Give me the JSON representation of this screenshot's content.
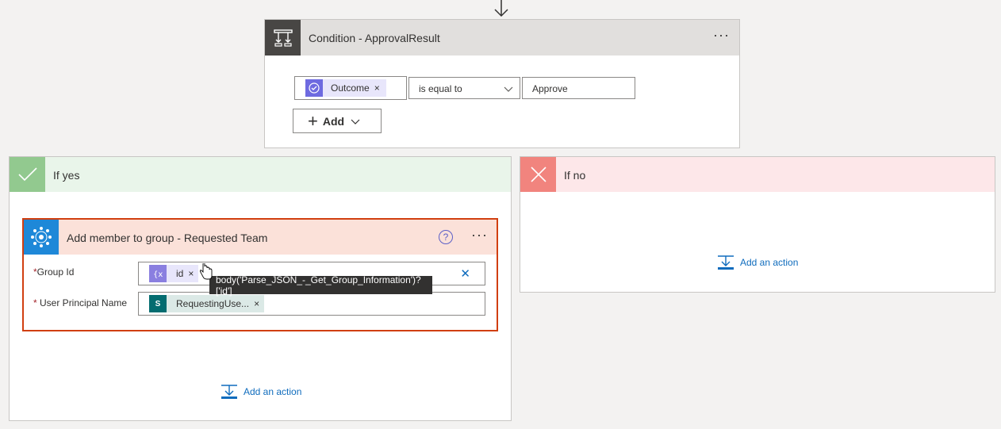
{
  "condition": {
    "title": "Condition - ApprovalResult",
    "more_label": "···",
    "left_operand": {
      "label": "Outcome",
      "remove": "×"
    },
    "operator": "is equal to",
    "right_value": "Approve",
    "add_button": "Add"
  },
  "yes_branch": {
    "title": "If yes",
    "action": {
      "title": "Add member to group - Requested Team",
      "help": "?",
      "more_label": "···",
      "fields": [
        {
          "required": "*",
          "label": "Group Id",
          "token": "id",
          "remove": "×",
          "clear": "✕"
        },
        {
          "required": "*",
          "label": "User Principal Name",
          "token": "RequestingUse...",
          "token_prefix": "S",
          "remove": "×"
        }
      ],
      "tooltip": "body('Parse_JSON_-_Get_Group_Information')?['id']"
    },
    "add_action": "Add an action"
  },
  "no_branch": {
    "title": "If no",
    "add_action": "Add an action"
  },
  "colors": {
    "accent": "#0f6cbd",
    "yes": "#92c98f",
    "no": "#f1847e",
    "action_border": "#d13f10"
  }
}
